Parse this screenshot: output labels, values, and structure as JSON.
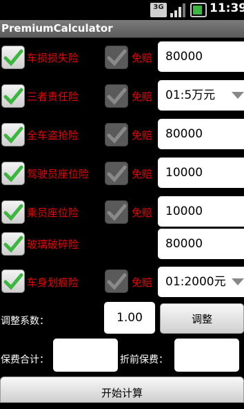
{
  "status_bar": {
    "network": "3G",
    "time": "11:39"
  },
  "app_title": "PremiumCalculator",
  "rows": [
    {
      "label": "车损损失险",
      "checked": true,
      "exempt_label": "免赔",
      "value": "80000",
      "type": "text"
    },
    {
      "label": "三者责任险",
      "checked": true,
      "exempt_label": "免赔",
      "value": "01:5万元",
      "type": "spinner"
    },
    {
      "label": "全车盗抢险",
      "checked": true,
      "exempt_label": "免赔",
      "value": "80000",
      "type": "text"
    },
    {
      "label": "驾驶员座位险",
      "checked": true,
      "exempt_label": "免赔",
      "value": "10000",
      "type": "text"
    },
    {
      "label": "乘员座位险",
      "checked": true,
      "exempt_label": "免赔",
      "value": "10000",
      "type": "text"
    },
    {
      "label": "玻璃破碎险",
      "checked": true,
      "value": "80000",
      "type": "text"
    },
    {
      "label": "车身划痕险",
      "checked": true,
      "exempt_label": "免赔",
      "value": "01:2000元",
      "type": "spinner"
    }
  ],
  "adjust": {
    "label": "调整系数：",
    "value": "1.00",
    "button": "调整"
  },
  "totals": {
    "total_label": "保费合计：",
    "total_value": "",
    "discount_label": "折前保费：",
    "discount_value": ""
  },
  "start_button": "开始计算",
  "colors": {
    "label": "#e00000",
    "background": "#000000",
    "check": "#3db640"
  }
}
